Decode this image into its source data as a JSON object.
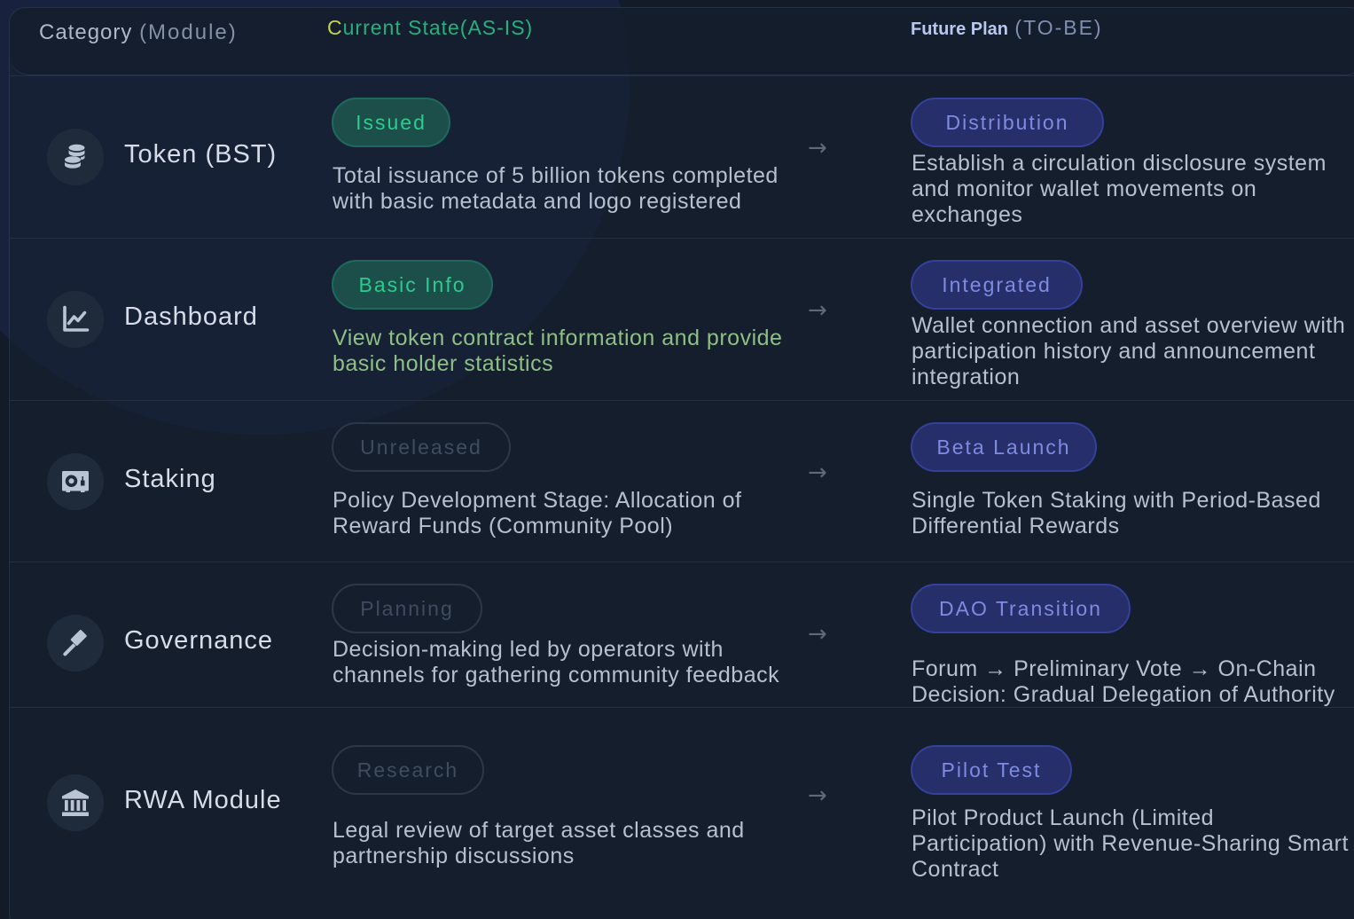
{
  "header": {
    "category_main": "Category",
    "category_sub": "(Module)",
    "current_first": "C",
    "current_rest": "urrent State(AS-IS)",
    "future_main": "Future Plan",
    "future_sub": "(TO-BE)"
  },
  "colors": {
    "background": "#131b28",
    "accent_green": "#2bcc8d",
    "accent_blue": "#7f8be0",
    "text_primary": "#d6dde8",
    "text_secondary": "#b6c0ce"
  },
  "arrow_glyph": "→",
  "rows": [
    {
      "icon": "coins-icon",
      "category": "Token (BST)",
      "current_badge": "Issued",
      "current_badge_style": "green",
      "current_text": "Total issuance of 5 billion tokens completed with basic metadata and logo registered",
      "future_badge": "Distribution",
      "future_text": "Establish a circulation disclosure system and monitor wallet movements on exchanges"
    },
    {
      "icon": "chart-line-icon",
      "category": "Dashboard",
      "current_badge": "Basic Info",
      "current_badge_style": "green",
      "current_text": "View token contract information and provide basic holder statistics",
      "future_badge": "Integrated",
      "future_text": "Wallet connection and asset overview with participation history and announcement integration"
    },
    {
      "icon": "vault-icon",
      "category": "Staking",
      "current_badge": "Unreleased",
      "current_badge_style": "gray",
      "current_text": "Policy Development Stage: Allocation of Reward Funds (Community Pool)",
      "future_badge": "Beta Launch",
      "future_text": "Single Token Staking with Period-Based Differential Rewards"
    },
    {
      "icon": "gavel-icon",
      "category": "Governance",
      "current_badge": "Planning",
      "current_badge_style": "gray",
      "current_text": "Decision-making led by operators with channels for gathering community feedback",
      "future_badge": "DAO Transition",
      "future_text": "Forum → Preliminary Vote → On-Chain Decision: Gradual Delegation of Authority"
    },
    {
      "icon": "landmark-icon",
      "category": "RWA Module",
      "current_badge": "Research",
      "current_badge_style": "gray",
      "current_text": "Legal review of target asset classes and partnership discussions",
      "future_badge": "Pilot Test",
      "future_text": "Pilot Product Launch (Limited Participation) with Revenue-Sharing Smart Contract"
    }
  ]
}
